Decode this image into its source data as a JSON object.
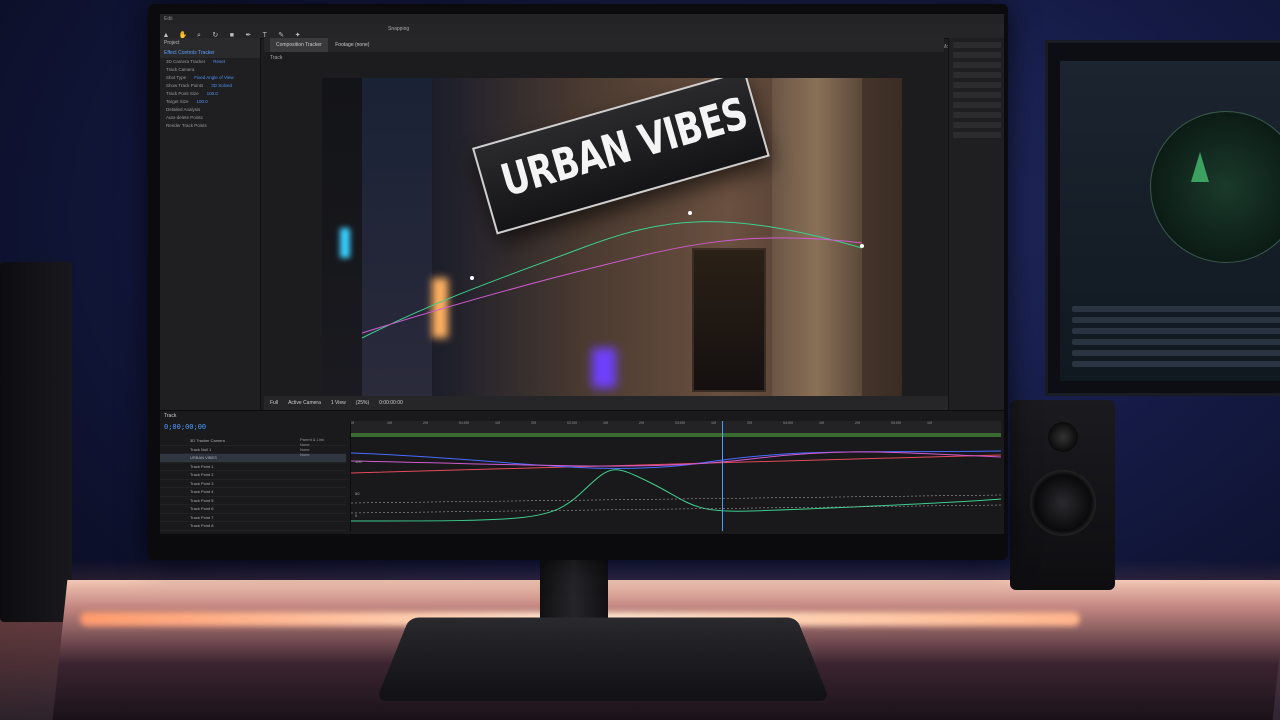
{
  "scene": {
    "main_monitor": {
      "app_menu": "Edit",
      "toolbar_snap_label": "Snapping",
      "workspaces": [
        "Default",
        "Review",
        "Learn",
        "Small Screen",
        "Standard",
        "Libraries",
        "Motion",
        "Overview"
      ],
      "left_panel": {
        "tabs": [
          "Project",
          "Effect Controls Tracker"
        ],
        "effect_rows": [
          {
            "label": "3D Camera Tracker",
            "value": "Reset"
          },
          {
            "label": "Track Camera",
            "value": ""
          },
          {
            "label": "Shot Type",
            "value": "Fixed Angle of View"
          },
          {
            "label": "Show Track Points",
            "value": "3D Solved"
          },
          {
            "label": "Track Point Size",
            "value": "100.0"
          },
          {
            "label": "Target Size",
            "value": "100.0"
          },
          {
            "label": "Detailed Analysis",
            "value": ""
          },
          {
            "label": "Auto-delete Points",
            "value": ""
          },
          {
            "label": "Render Track Points",
            "value": ""
          }
        ]
      },
      "composition": {
        "tab_label": "Composition Tracker",
        "footage_tab": "Footage (none)",
        "breadcrumb": "Track",
        "sign_text": "URBAN VIBES",
        "viewer_controls": [
          "Full",
          "Active Camera",
          "1 View",
          "(25%)",
          "0:00:00:00"
        ]
      },
      "timeline": {
        "tab_label": "Track",
        "timecode": "0;00;00;00",
        "layers": [
          "3D Tracker Camera",
          "Track Null 1",
          "URBAN VIBES",
          "Track Point 1",
          "Track Point 2",
          "Track Point 3",
          "Track Point 4",
          "Track Point 5",
          "Track Point 6",
          "Track Point 7",
          "Track Point 8"
        ],
        "mode_header": "Parent & Link",
        "mode_values": [
          "None",
          "None",
          "None"
        ],
        "ruler_ticks": [
          "0f",
          "10f",
          "20f",
          "01:00f",
          "10f",
          "20f",
          "02:00f",
          "10f",
          "20f",
          "03:00f",
          "10f",
          "20f",
          "04:00f",
          "10f",
          "20f",
          "05:00f",
          "10f"
        ],
        "graph_labels": [
          "100",
          "50",
          "0"
        ],
        "playhead_position": 0.57
      }
    },
    "colors": {
      "accent_blue": "#4f9cff",
      "curve_red": "#e24a5a",
      "curve_green": "#3ecf8e",
      "curve_blue": "#4a6cff",
      "curve_pink": "#d05ad0",
      "led_strip": "#ffb58c"
    },
    "icons": [
      "selection-tool-icon",
      "hand-tool-icon",
      "zoom-tool-icon",
      "rotate-tool-icon",
      "camera-tool-icon",
      "pen-tool-icon",
      "text-tool-icon",
      "brush-tool-icon",
      "puppet-tool-icon"
    ]
  }
}
